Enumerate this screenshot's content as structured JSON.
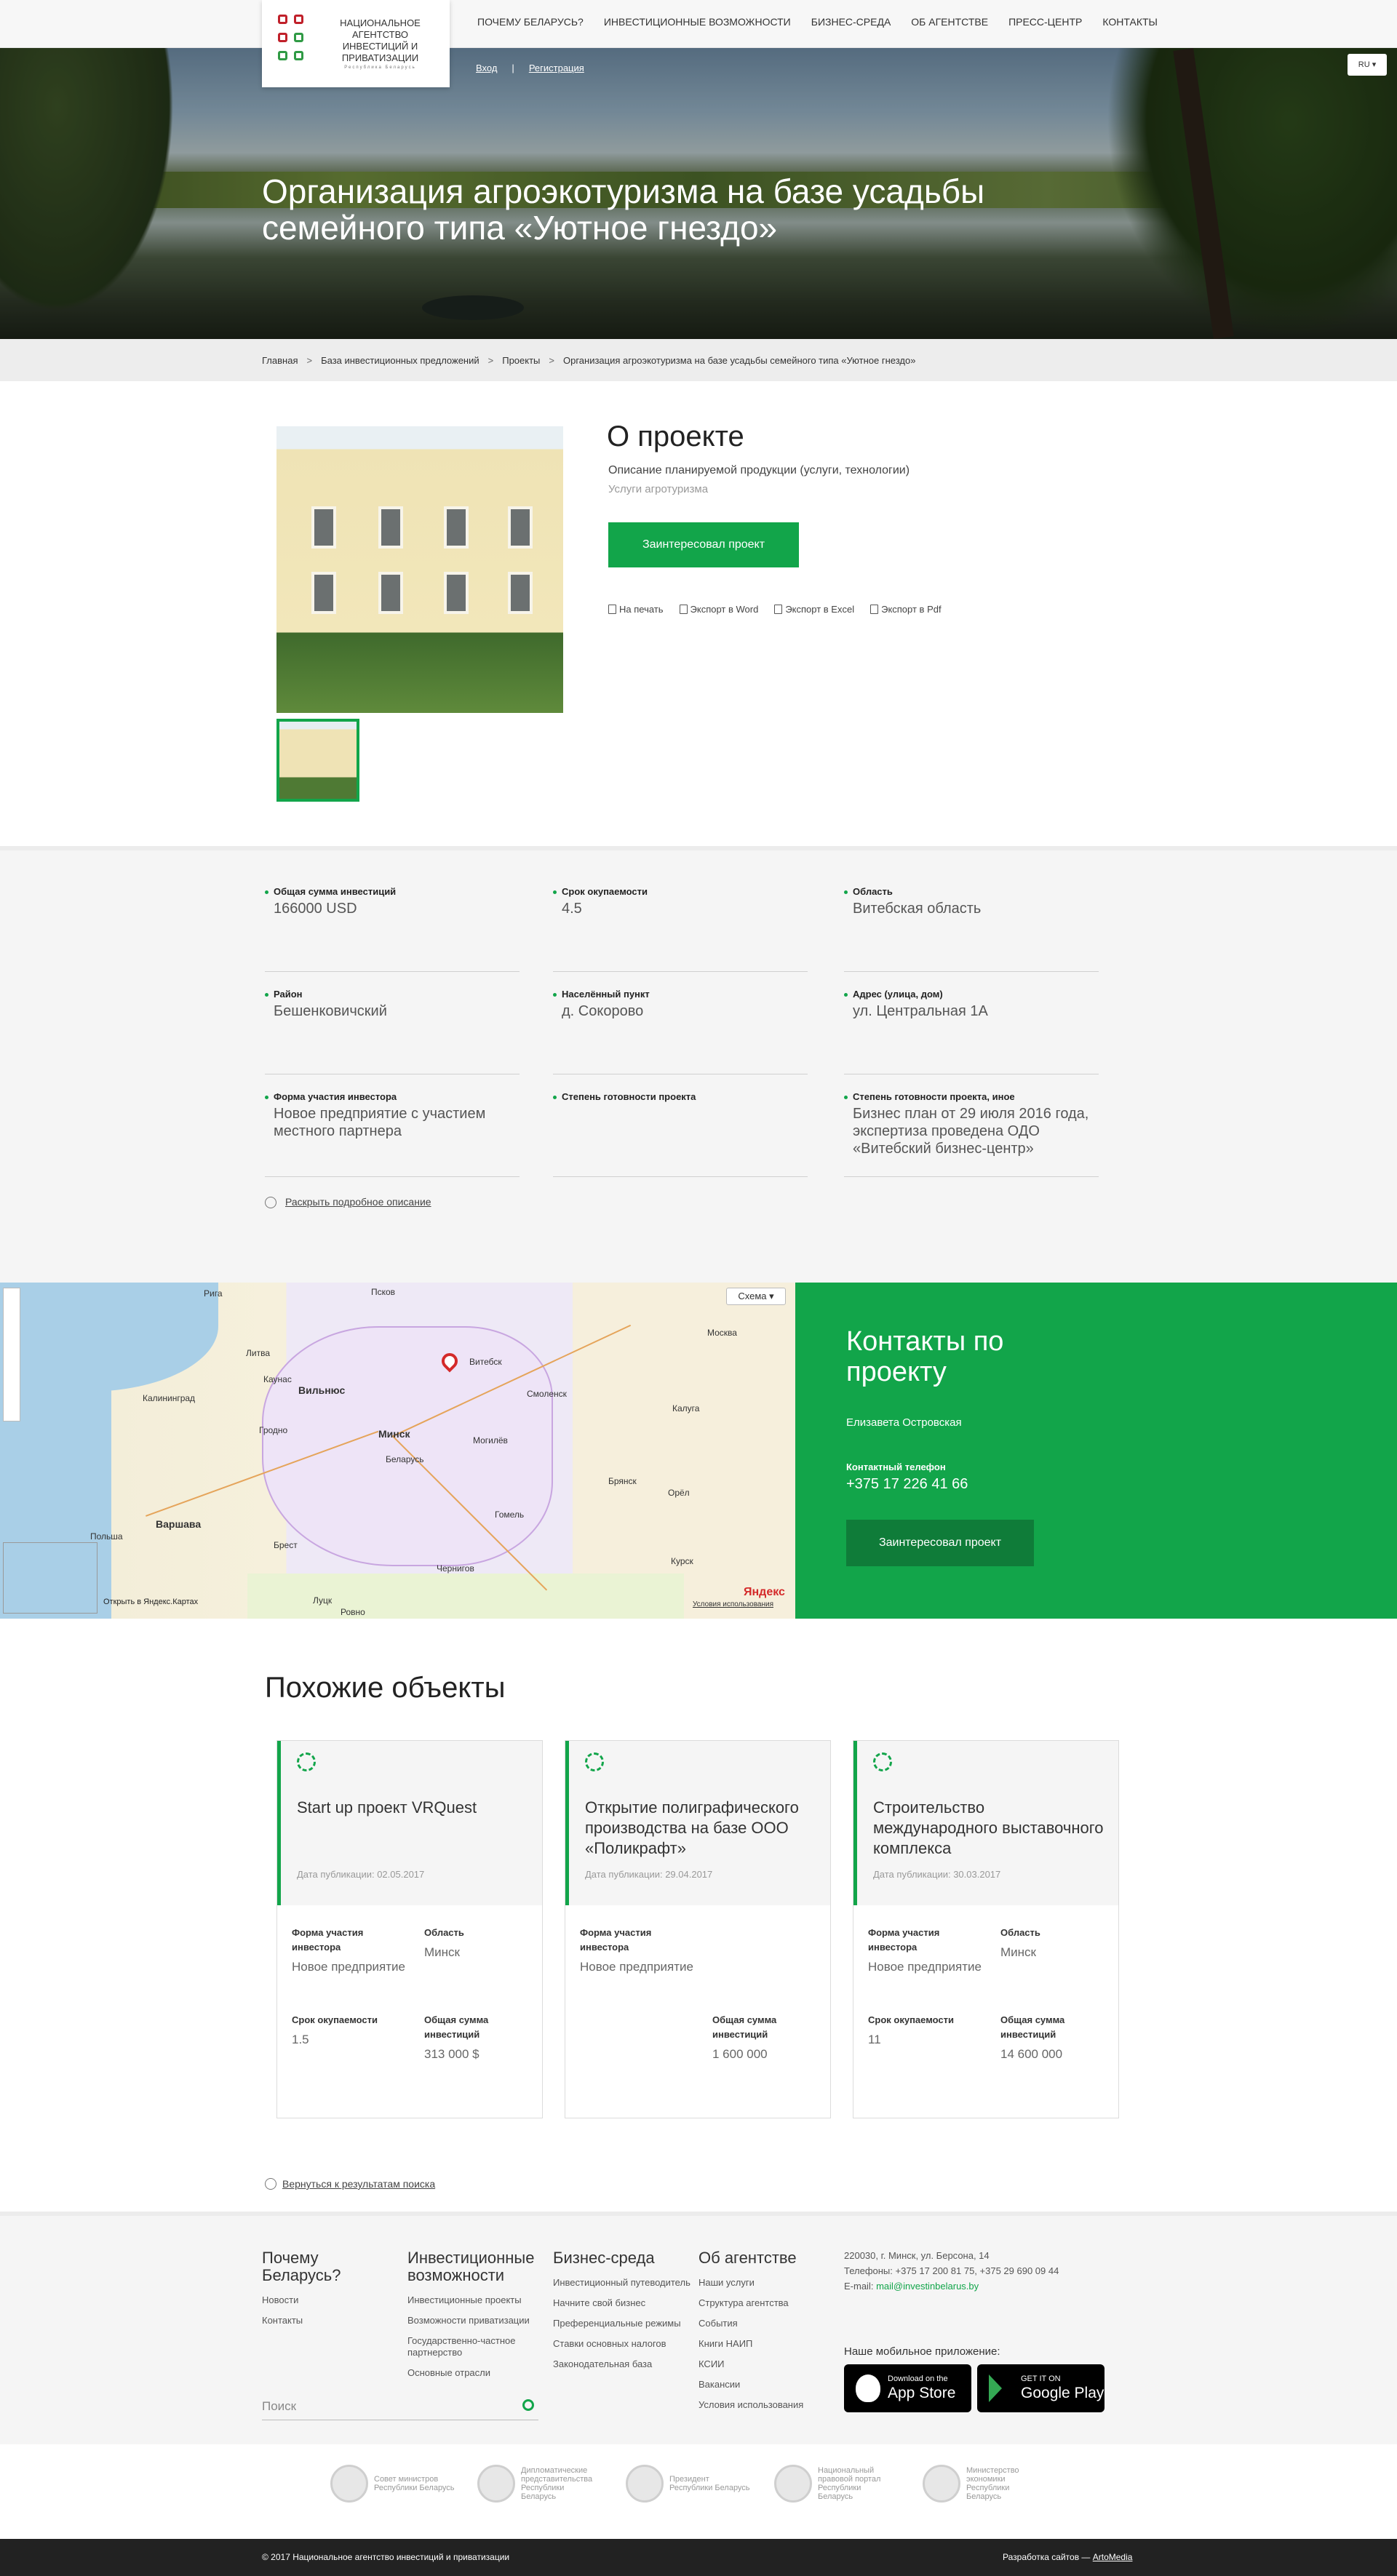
{
  "header": {
    "logo_text": "Национальное агентство инвестиций и приватизации",
    "logo_sub": "Республика Беларусь",
    "nav": [
      "Почему Беларусь?",
      "Инвестиционные возможности",
      "Бизнес-среда",
      "Об агентстве",
      "Пресс-центр",
      "Контакты"
    ],
    "login": "Вход",
    "register": "Регистрация",
    "lang": "RU ▾"
  },
  "hero": {
    "title": "Организация агроэкотуризма на базе усадьбы семейного типа «Уютное гнездо»"
  },
  "breadcrumb": [
    "Главная",
    "База инвестиционных предложений",
    "Проекты",
    "Организация агроэкотуризма на базе усадьбы семейного типа «Уютное гнездо»"
  ],
  "about": {
    "title": "О проекте",
    "product_label": "Описание планируемой продукции (услуги, технологии)",
    "product_value": "Услуги агротуризма",
    "interest_button": "Заинтересовал проект",
    "exports": [
      "На печать",
      "Экспорт в Word",
      "Экспорт в Excel",
      "Экспорт в Pdf"
    ]
  },
  "details": [
    {
      "label": "Общая сумма инвестиций",
      "value": "166000 USD"
    },
    {
      "label": "Срок окупаемости",
      "value": "4.5"
    },
    {
      "label": "Область",
      "value": "Витебская область"
    },
    {
      "label": "Район",
      "value": "Бешенковичский"
    },
    {
      "label": "Населённый пункт",
      "value": "д. Сокорово"
    },
    {
      "label": "Адрес (улица, дом)",
      "value": "ул. Центральная 1А"
    },
    {
      "label": "Форма участия инвестора",
      "value": "Новое предприятие с участием местного партнера"
    },
    {
      "label": "Степень готовности проекта",
      "value": ""
    },
    {
      "label": "Степень готовности проекта, иное",
      "value": "Бизнес план от 29 июля 2016 года, экспертиза проведена ОДО «Витебский бизнес-центр»"
    }
  ],
  "expand_link": "Раскрыть подробное описание",
  "map": {
    "scheme": "Схема ▾",
    "open_link": "Открыть в Яндекс.Картах",
    "brand": "Яндекс",
    "terms": "Условия использования",
    "cities": [
      {
        "name": "Вильнюс",
        "bold": true
      },
      {
        "name": "Минск",
        "bold": true
      },
      {
        "name": "Москва",
        "bold": false
      },
      {
        "name": "Варшава",
        "bold": true
      },
      {
        "name": "Витебск",
        "bold": false
      },
      {
        "name": "Могилёв",
        "bold": false
      },
      {
        "name": "Гомель",
        "bold": false
      },
      {
        "name": "Брест",
        "bold": false
      },
      {
        "name": "Смоленск",
        "bold": false
      },
      {
        "name": "Калуга",
        "bold": false
      },
      {
        "name": "Брянск",
        "bold": false
      },
      {
        "name": "Орёл",
        "bold": false
      },
      {
        "name": "Курск",
        "bold": false
      },
      {
        "name": "Рига",
        "bold": false
      },
      {
        "name": "Литва",
        "bold": false
      },
      {
        "name": "Польша",
        "bold": false
      },
      {
        "name": "Беларусь",
        "bold": false
      },
      {
        "name": "Калининград",
        "bold": false
      },
      {
        "name": "Каунас",
        "bold": false
      },
      {
        "name": "Гродно",
        "bold": false
      },
      {
        "name": "Чернигов",
        "bold": false
      },
      {
        "name": "Псков",
        "bold": false
      },
      {
        "name": "Луцк",
        "bold": false
      },
      {
        "name": "Ровно",
        "bold": false
      }
    ]
  },
  "contacts": {
    "title": "Контакты по проекту",
    "name": "Елизавета Островская",
    "phone_label": "Контактный телефон",
    "phone": "+375 17 226 41 66",
    "button": "Заинтересовал проект"
  },
  "similar": {
    "title": "Похожие объекты",
    "cards": [
      {
        "title": "Start up проект VRQuest",
        "date": "Дата публикации: 02.05.2017",
        "form_label": "Форма участия инвестора",
        "form": "Новое предприятие",
        "region_label": "Область",
        "region": "Минск",
        "payback_label": "Срок окупаемости",
        "payback": "1.5",
        "sum_label": "Общая сумма инвестиций",
        "sum": "313 000 $"
      },
      {
        "title": "Открытие полиграфического производства на базе ООО «Поликрафт»",
        "date": "Дата публикации: 29.04.2017",
        "form_label": "Форма участия инвестора",
        "form": "Новое предприятие",
        "region_label": "",
        "region": "",
        "payback_label": "",
        "payback": "",
        "sum_label": "Общая сумма инвестиций",
        "sum": "1 600 000"
      },
      {
        "title": "Строительство международного выставочного комплекса",
        "date": "Дата публикации: 30.03.2017",
        "form_label": "Форма участия инвестора",
        "form": "Новое предприятие",
        "region_label": "Область",
        "region": "Минск",
        "payback_label": "Срок окупаемости",
        "payback": "11",
        "sum_label": "Общая сумма инвестиций",
        "sum": "14 600 000"
      }
    ]
  },
  "back_link": "Вернуться к результатам поиска",
  "footer": {
    "cols": [
      {
        "head": "Почему Беларусь?",
        "items": [
          "Новости",
          "Контакты"
        ]
      },
      {
        "head": "Инвестиционные возможности",
        "items": [
          "Инвестиционные проекты",
          "Возможности приватизации",
          "Государственно-частное партнерство",
          "Основные отрасли"
        ]
      },
      {
        "head": "Бизнес-среда",
        "items": [
          "Инвестиционный путеводитель",
          "Начните свой бизнес",
          "Преференциальные режимы",
          "Ставки основных налогов",
          "Законодательная база"
        ]
      },
      {
        "head": "Об агентстве",
        "items": [
          "Наши услуги",
          "Структура агентства",
          "События",
          "Книги НАИП",
          "КСИИ",
          "Вакансии",
          "Условия использования"
        ]
      }
    ],
    "search_placeholder": "Поиск",
    "address": "220030, г. Минск, ул. Берсона, 14",
    "phones": "Телефоны: +375 17 200 81 75, +375 29 690 09 44",
    "email_label": "E-mail: ",
    "email": "mail@investinbelarus.by",
    "mobile_label": "Наше мобильное приложение:",
    "appstore_small": "Download on the",
    "appstore_big": "App Store",
    "gplay_small": "GET IT ON",
    "gplay_big": "Google Play",
    "gov": [
      {
        "name": "Совет министров",
        "sub": "Республики Беларусь"
      },
      {
        "name": "Дипломатические представительства",
        "sub": "Республики Беларусь"
      },
      {
        "name": "Президент",
        "sub": "Республики Беларусь"
      },
      {
        "name": "Национальный правовой портал",
        "sub": "Республики Беларусь"
      },
      {
        "name": "Министерство экономики",
        "sub": "Республики Беларусь"
      }
    ],
    "copyright": "© 2017 Национальное агентство инвестиций и приватизации",
    "dev_label": "Разработка сайтов — ",
    "dev": "ArtoMedia"
  }
}
